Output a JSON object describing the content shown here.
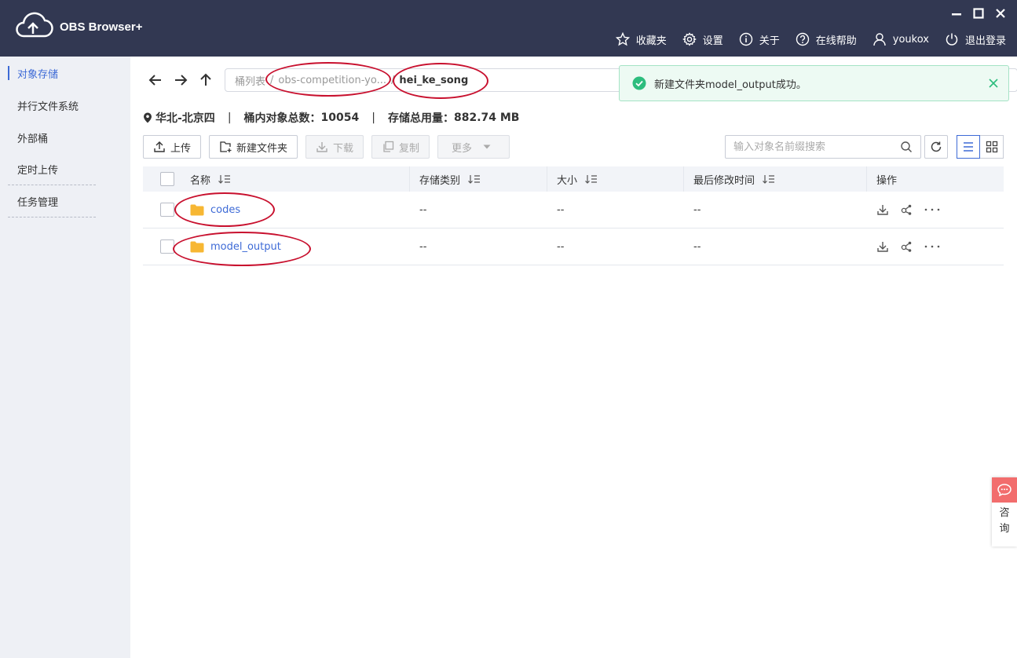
{
  "app": {
    "title": "OBS Browser+"
  },
  "topnav": {
    "favorites": "收藏夹",
    "settings": "设置",
    "about": "关于",
    "help": "在线帮助",
    "user": "youkox",
    "logout": "退出登录"
  },
  "sidebar": {
    "items": [
      {
        "label": "对象存储"
      },
      {
        "label": "并行文件系统"
      },
      {
        "label": "外部桶"
      },
      {
        "label": "定时上传"
      },
      {
        "label": "任务管理"
      }
    ]
  },
  "path": {
    "root": "桶列表",
    "bucket": "obs-competition-yo...",
    "current": "hei_ke_song"
  },
  "toast": {
    "message": "新建文件夹model_output成功。"
  },
  "info": {
    "region": "华北-北京四",
    "objects_label": "桶内对象总数：",
    "objects_value": "10054",
    "storage_label": "存储总用量：",
    "storage_value": "882.74 MB"
  },
  "toolbar": {
    "upload": "上传",
    "new_folder": "新建文件夹",
    "download": "下载",
    "copy": "复制",
    "more": "更多"
  },
  "search": {
    "placeholder": "输入对象名前缀搜索"
  },
  "table": {
    "headers": {
      "name": "名称",
      "type": "存储类别",
      "size": "大小",
      "time": "最后修改时间",
      "ops": "操作"
    },
    "rows": [
      {
        "name": "codes",
        "type": "--",
        "size": "--",
        "time": "--"
      },
      {
        "name": "model_output",
        "type": "--",
        "size": "--",
        "time": "--"
      }
    ]
  },
  "consult": {
    "line1": "咨",
    "line2": "询"
  },
  "colors": {
    "titlebar": "#323852",
    "accent": "#3d6ad6",
    "sidebar": "#eef0f5",
    "success": "#2dbd7e",
    "annotation": "#c8102e",
    "folder": "#f7b733"
  }
}
